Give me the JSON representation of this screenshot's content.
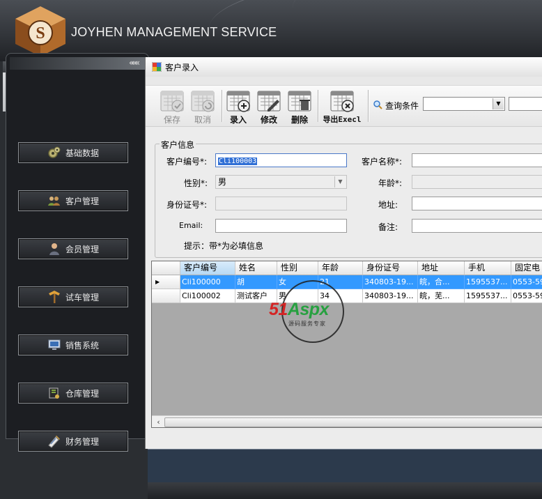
{
  "app": {
    "brand": "JOYHEN  MANAGEMENT SERVICE"
  },
  "sidebar": {
    "collapse": "«««",
    "items": [
      {
        "label": "基础数据",
        "icon": "gears-icon"
      },
      {
        "label": "客户管理",
        "icon": "users-icon"
      },
      {
        "label": "会员管理",
        "icon": "member-icon"
      },
      {
        "label": "试车管理",
        "icon": "signpost-icon"
      },
      {
        "label": "销售系统",
        "icon": "monitor-icon"
      },
      {
        "label": "仓库管理",
        "icon": "warehouse-icon"
      },
      {
        "label": "财务管理",
        "icon": "finance-icon"
      }
    ]
  },
  "window": {
    "title": "客户录入"
  },
  "toolbar": {
    "save": "保存",
    "cancel": "取消",
    "add": "录入",
    "edit": "修改",
    "delete": "删除",
    "export": "导出Execl",
    "query_label": "查询条件"
  },
  "form": {
    "group_title": "客户信息",
    "code_label": "客户编号*:",
    "code_value": "Cli100003",
    "name_label": "客户名称*:",
    "gender_label": "性别*:",
    "gender_value": "男",
    "age_label": "年龄*:",
    "idcard_label": "身份证号*:",
    "idcard_value": "-        -",
    "address_label": "地址:",
    "email_label": "Email:",
    "remark_label": "备注:",
    "hint": "提示：带*为必填信息"
  },
  "grid": {
    "columns": [
      "客户编号",
      "姓名",
      "性别",
      "年龄",
      "身份证号",
      "地址",
      "手机",
      "固定电"
    ],
    "rows": [
      {
        "code": "Cli100000",
        "name": "胡",
        "gender": "女",
        "age": "21",
        "idcard": "340803-19...",
        "address": "皖，合...",
        "mobile": "1595537...",
        "phone": "0553-59"
      },
      {
        "code": "Cli100002",
        "name": "测试客户",
        "gender": "男",
        "age": "34",
        "idcard": "340803-19...",
        "address": "皖，芜...",
        "mobile": "1595537...",
        "phone": "0553-59"
      }
    ],
    "scroll_left": "‹"
  },
  "watermark": {
    "brand_red": "51",
    "brand_green": "Aspx",
    "sub": "源码服务专家"
  },
  "colors": {
    "selection": "#3399ff",
    "header_bg": "#33363b",
    "accent": "#c0783a"
  }
}
